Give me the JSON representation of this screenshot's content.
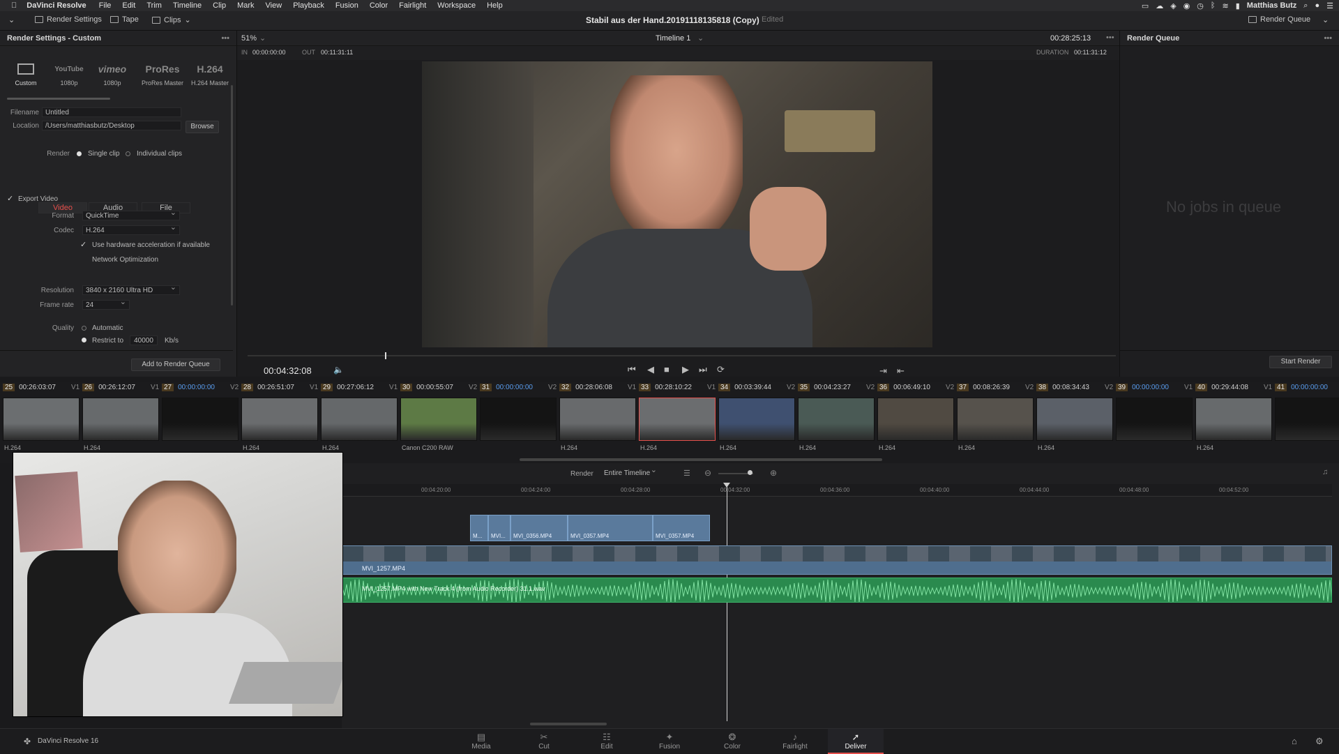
{
  "menubar": {
    "app": "DaVinci Resolve",
    "items": [
      "File",
      "Edit",
      "Trim",
      "Timeline",
      "Clip",
      "Mark",
      "View",
      "Playback",
      "Fusion",
      "Color",
      "Fairlight",
      "Workspace",
      "Help"
    ],
    "user": "Matthias Butz"
  },
  "toolbar": {
    "render_settings": "Render Settings",
    "tape": "Tape",
    "clips": "Clips",
    "project_title": "Stabil aus der Hand.20191118135818 (Copy)",
    "edited": "Edited",
    "render_queue": "Render Queue"
  },
  "render": {
    "header": "Render Settings - Custom",
    "presets": [
      {
        "name": "",
        "sub": "Custom"
      },
      {
        "name": "YouTube",
        "sub": "1080p"
      },
      {
        "name": "vimeo",
        "sub": "1080p"
      },
      {
        "name": "ProRes",
        "sub": "ProRes Master"
      },
      {
        "name": "H.264",
        "sub": "H.264 Master"
      }
    ],
    "filename_label": "Filename",
    "filename_value": "Untitled",
    "location_label": "Location",
    "location_value": "/Users/matthiasbutz/Desktop",
    "browse": "Browse",
    "render_label": "Render",
    "single_clip": "Single clip",
    "individual_clips": "Individual clips",
    "tabs": [
      "Video",
      "Audio",
      "File"
    ],
    "export_video": "Export Video",
    "format_label": "Format",
    "format_value": "QuickTime",
    "codec_label": "Codec",
    "codec_value": "H.264",
    "hw_accel": "Use hardware acceleration if available",
    "network_opt": "Network Optimization",
    "resolution_label": "Resolution",
    "resolution_value": "3840 x 2160 Ultra HD",
    "framerate_label": "Frame rate",
    "framerate_value": "24",
    "quality_label": "Quality",
    "automatic": "Automatic",
    "restrict_to": "Restrict to",
    "restrict_value": "40000",
    "kbs": "Kb/s",
    "add_queue": "Add to Render Queue"
  },
  "viewer": {
    "zoom": "51%",
    "timeline": "Timeline 1",
    "timecode": "00:28:25:13",
    "in_label": "IN",
    "in_value": "00:00:00:00",
    "out_label": "OUT",
    "out_value": "00:11:31:11",
    "duration_label": "DURATION",
    "duration_value": "00:11:31:12",
    "current_tc": "00:04:32:08"
  },
  "queue": {
    "header": "Render Queue",
    "empty": "No jobs in queue",
    "start": "Start Render"
  },
  "clips": [
    {
      "num": "25",
      "tc": "00:26:03:07",
      "track": "V1",
      "label": "H.264",
      "color": "#6b6e70"
    },
    {
      "num": "26",
      "tc": "00:26:12:07",
      "track": "V1",
      "label": "H.264",
      "color": "#676a6c"
    },
    {
      "num": "27",
      "tc": "00:00:00:00",
      "track": "V2",
      "label": "",
      "color": "#141414"
    },
    {
      "num": "28",
      "tc": "00:26:51:07",
      "track": "V1",
      "label": "H.264",
      "color": "#6a6c6e"
    },
    {
      "num": "29",
      "tc": "00:27:06:12",
      "track": "V1",
      "label": "H.264",
      "color": "#65686a"
    },
    {
      "num": "30",
      "tc": "00:00:55:07",
      "track": "V2",
      "label": "Canon C200 RAW",
      "color": "#5d7a45"
    },
    {
      "num": "31",
      "tc": "00:00:00:00",
      "track": "V2",
      "label": "",
      "color": "#141414"
    },
    {
      "num": "32",
      "tc": "00:28:06:08",
      "track": "V1",
      "label": "H.264",
      "color": "#686a6c"
    },
    {
      "num": "33",
      "tc": "00:28:10:22",
      "track": "V1",
      "label": "H.264",
      "color": "#6b6d6f"
    },
    {
      "num": "34",
      "tc": "00:03:39:44",
      "track": "V2",
      "label": "H.264",
      "color": "#3f5070"
    },
    {
      "num": "35",
      "tc": "00:04:23:27",
      "track": "V2",
      "label": "H.264",
      "color": "#4a5a55"
    },
    {
      "num": "36",
      "tc": "00:06:49:10",
      "track": "V2",
      "label": "H.264",
      "color": "#504a42"
    },
    {
      "num": "37",
      "tc": "00:08:26:39",
      "track": "V2",
      "label": "H.264",
      "color": "#56524c"
    },
    {
      "num": "38",
      "tc": "00:08:34:43",
      "track": "V2",
      "label": "H.264",
      "color": "#5b6068"
    },
    {
      "num": "39",
      "tc": "00:00:00:00",
      "track": "V1",
      "label": "",
      "color": "#141414"
    },
    {
      "num": "40",
      "tc": "00:29:44:08",
      "track": "V1",
      "label": "H.264",
      "color": "#676a6c"
    },
    {
      "num": "41",
      "tc": "00:00:00:00",
      "track": "",
      "label": "",
      "color": "#141414"
    }
  ],
  "timeline": {
    "render_label": "Render",
    "render_value": "Entire Timeline",
    "ruler": [
      "00:04:20:00",
      "00:04:24:00",
      "00:04:28:00",
      "00:04:32:00",
      "00:04:36:00",
      "00:04:40:00",
      "00:04:44:00",
      "00:04:48:00",
      "00:04:52:00"
    ],
    "v2_clips": [
      "M...",
      "MVI...",
      "MVI_0356.MP4",
      "MVI_0357.MP4",
      "MVI_0357.MP4"
    ],
    "v1_clip": "MVI_1257.MP4",
    "a1_clip": "MVI_1257.MP4 with New Track 4 (from Audio Recorder) 31.1.wav"
  },
  "nav": {
    "brand": "DaVinci Resolve 16",
    "pages": [
      "Media",
      "Cut",
      "Edit",
      "Fusion",
      "Color",
      "Fairlight",
      "Deliver"
    ],
    "active": "Deliver"
  },
  "colors": {
    "accent": "#e6504c",
    "audio": "#2fa15a",
    "video_clip": "#5a7a9c"
  }
}
